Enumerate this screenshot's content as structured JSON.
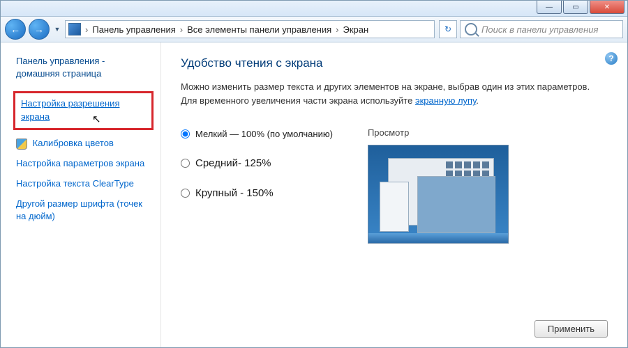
{
  "titlebar": {
    "minimize": "—",
    "maximize": "▭",
    "close": "✕"
  },
  "nav": {
    "back_glyph": "←",
    "fwd_glyph": "→",
    "dropdown_glyph": "▼",
    "refresh_glyph": "↻",
    "address_prefix_glyph": "›",
    "crumb1": "Панель управления",
    "crumb2": "Все элементы панели управления",
    "crumb3": "Экран",
    "search_placeholder": "Поиск в панели управления"
  },
  "sidebar": {
    "home": "Панель управления - домашняя страница",
    "link_resolution": "Настройка разрешения экрана",
    "link_calibration": "Калибровка цветов",
    "link_display_params": "Настройка параметров экрана",
    "link_cleartype": "Настройка текста ClearType",
    "link_dpi": "Другой размер шрифта (точек на дюйм)"
  },
  "content": {
    "heading": "Удобство чтения с экрана",
    "description_pre": "Можно изменить размер текста и других элементов на экране, выбрав один из этих параметров. Для временного увеличения части экрана используйте ",
    "magnifier_link": "экранную лупу",
    "description_post": ".",
    "options": {
      "small": "Мелкий — 100% (по умолчанию)",
      "medium": "Средний- 125%",
      "large": "Крупный - 150%"
    },
    "preview_label": "Просмотр",
    "apply": "Применить",
    "help_glyph": "?"
  }
}
